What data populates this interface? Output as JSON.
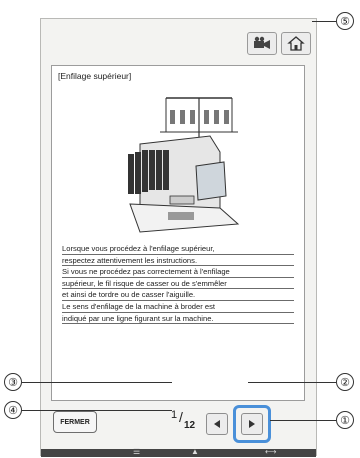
{
  "card": {
    "title": "[Enfilage supérieur]",
    "lines": [
      " Lorsque vous procédez à l'enfilage supérieur,",
      "respectez attentivement les instructions.",
      " Si vous ne procédez pas correctement à l'enfilage",
      "supérieur, le fil risque de casser ou de s'emmêler",
      "et ainsi de tordre ou de casser l'aiguille.",
      " Le sens d'enfilage de la machine à broder est",
      "indiqué par une ligne figurant sur la machine."
    ]
  },
  "bottom": {
    "close_label": "FERMER",
    "page_current": "1",
    "page_total": "12"
  },
  "strip": {
    "right_glyph": "⟷"
  },
  "callouts": {
    "c1": "①",
    "c2": "②",
    "c3": "③",
    "c4": "④",
    "c5": "⑤"
  },
  "icons": {
    "video": "video-camera-icon",
    "home": "home-icon",
    "prev": "arrow-left-icon",
    "next": "arrow-right-icon"
  },
  "colors": {
    "highlight": "#4a90d9",
    "screen_bg": "#f3f3f1"
  }
}
